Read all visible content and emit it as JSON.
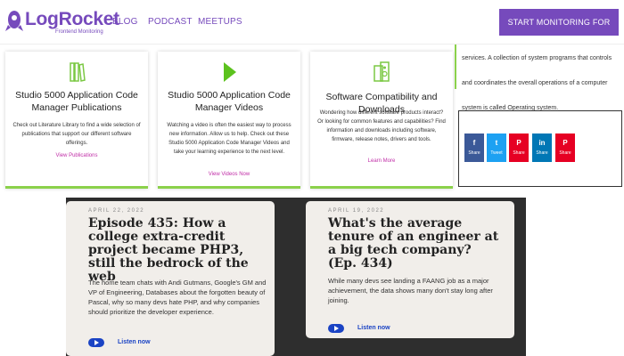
{
  "header": {
    "logo_text": "LogRocket",
    "logo_tagline": "Frontend Monitoring",
    "nav": [
      "BLOG",
      "PODCAST",
      "MEETUPS"
    ],
    "cta": "START MONITORING FOR FREE"
  },
  "cards": [
    {
      "icon": "books-icon",
      "title": "Studio 5000 Application Code Manager Publications",
      "body": "Check out Literature Library to find a wide selection of publications that support our different software offerings.",
      "link": "View Publications"
    },
    {
      "icon": "play-icon",
      "title": "Studio 5000 Application Code Manager Videos",
      "body": "Watching a video is often the easiest way to process new information. Allow us to help. Check out these Studio 5000 Application Code Manager Videos and take your learning experience to the next level.",
      "link": "View Videos Now"
    },
    {
      "icon": "devices-icon",
      "title": "Software Compatibility and Downloads",
      "body": "Wondering how different software products interact? Or looking for common features and capabilities? Find information and downloads including software, firmware, release notes, drivers and tools.",
      "link": "Learn More"
    }
  ],
  "sidebar": {
    "text": "services. A collection of system programs that controls and coordinates the overall operations of a computer system is called Operating system.",
    "share_buttons": [
      {
        "label": "Share",
        "icon": "facebook-icon",
        "glyph": "f",
        "color": "#3b5998"
      },
      {
        "label": "Tweet",
        "icon": "twitter-icon",
        "glyph": "t",
        "color": "#1da1f2"
      },
      {
        "label": "Share",
        "icon": "pinterest-icon",
        "glyph": "P",
        "color": "#e60023"
      },
      {
        "label": "Share",
        "icon": "linkedin-icon",
        "glyph": "in",
        "color": "#0077b5"
      },
      {
        "label": "Share",
        "icon": "pinterest-icon",
        "glyph": "P",
        "color": "#e60023"
      }
    ]
  },
  "podcasts": [
    {
      "date": "APRIL 22, 2022",
      "title": "Episode 435: How a college extra-credit project became PHP3, still the bedrock of the web",
      "description": "The home team chats with Andi Gutmans, Google's GM and VP of Engineering, Databases about the forgotten beauty of Pascal, why so many devs hate PHP, and why companies should prioritize the developer experience.",
      "cta": "Listen now"
    },
    {
      "date": "APRIL 19, 2022",
      "title": "What's the average tenure of an engineer at a big tech company? (Ep. 434)",
      "description": "While many devs see landing a FAANG job as a major achievement, the data shows many don't stay long after joining.",
      "cta": "Listen now"
    }
  ],
  "colors": {
    "brand": "#764abc",
    "accent_green": "#8bd14b",
    "link_magenta": "#c02ea7",
    "podcast_blue": "#1a43c4"
  }
}
